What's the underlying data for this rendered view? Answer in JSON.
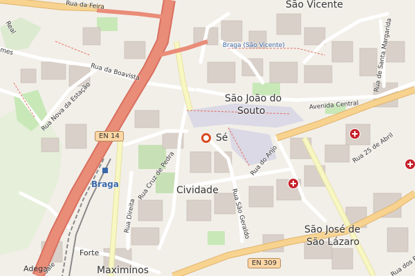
{
  "places": {
    "sao_vicente": "São Vicente",
    "sao_joao_do_souto_l1": "São João do",
    "sao_joao_do_souto_l2": "Souto",
    "se": "Sé",
    "cividade": "Cividade",
    "sao_jose_l1": "São José de",
    "sao_jose_l2": "São Lázaro",
    "maximinos": "Maximinos",
    "forte": "Forte",
    "adega": "Adega"
  },
  "streets": {
    "rua_da_feira": "Rua da Feira",
    "braga_sao_vicente": "Braga (São Vicente)",
    "rua_da_boavista": "Rua da Boavista",
    "rua_nova_da_estacao": "Rua Nova da Estação",
    "avenida_central": "Avenida Central",
    "rua_25_de_abril": "Rua 25 de Abril",
    "rua_de_santa_margarida": "Rua de Santa Margarida",
    "rua_cruz_de_pedra": "Rua Cruz de Pedra",
    "rua_do_anjo": "Rua do Anjo",
    "rua_direita": "Rua Direita",
    "rua_sao_geraldo": "Rua São Geraldo",
    "rua_real": "Real",
    "rua_mes": "mes",
    "rua_dos_ba": "Rua dos Ba",
    "rua_sale": "Sale"
  },
  "shields": {
    "en14": "EN 14",
    "en309": "EN 309"
  },
  "transit": {
    "braga_station": "Braga"
  },
  "colors": {
    "background": "#f2efe9",
    "motorway": "#e98c78",
    "primary_road": "#f7d38f",
    "secondary_road": "#f7f7c2",
    "minor_road": "#ffffff",
    "park": "#c8e8b8",
    "building": "#d9d0c9",
    "pedestrian": "#dad9e5",
    "railway": "#888888",
    "marker": "#d9481e",
    "hospital": "#c6212b"
  },
  "icons": {
    "location_marker": "location-pin-icon",
    "hospital": "hospital-cross-icon",
    "train_station": "train-station-icon"
  }
}
